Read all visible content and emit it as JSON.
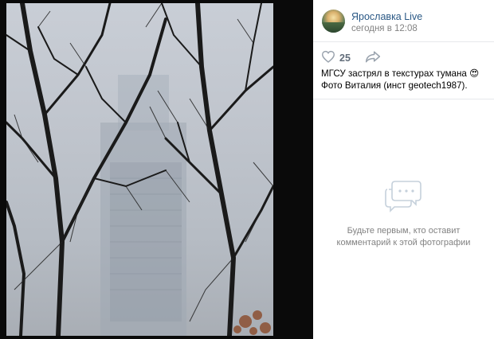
{
  "post": {
    "group_name": "Ярославка Live",
    "time": "сегодня в 12:08",
    "likes": "25",
    "caption_text": "МГСУ застрял в текстурах тумана ",
    "caption_emoji": "😍",
    "caption_rest": " Фото Виталия (инст geotech1987)."
  },
  "comments": {
    "empty_message": "Будьте первым, кто оставит комментарий к этой фотографии"
  },
  "icons": {
    "like": "heart-icon",
    "share": "share-arrow-icon",
    "empty": "chat-bubble-icon"
  },
  "colors": {
    "link": "#2a5885",
    "muted": "#828282",
    "count": "#626d7a",
    "icon": "#99a2ad"
  }
}
